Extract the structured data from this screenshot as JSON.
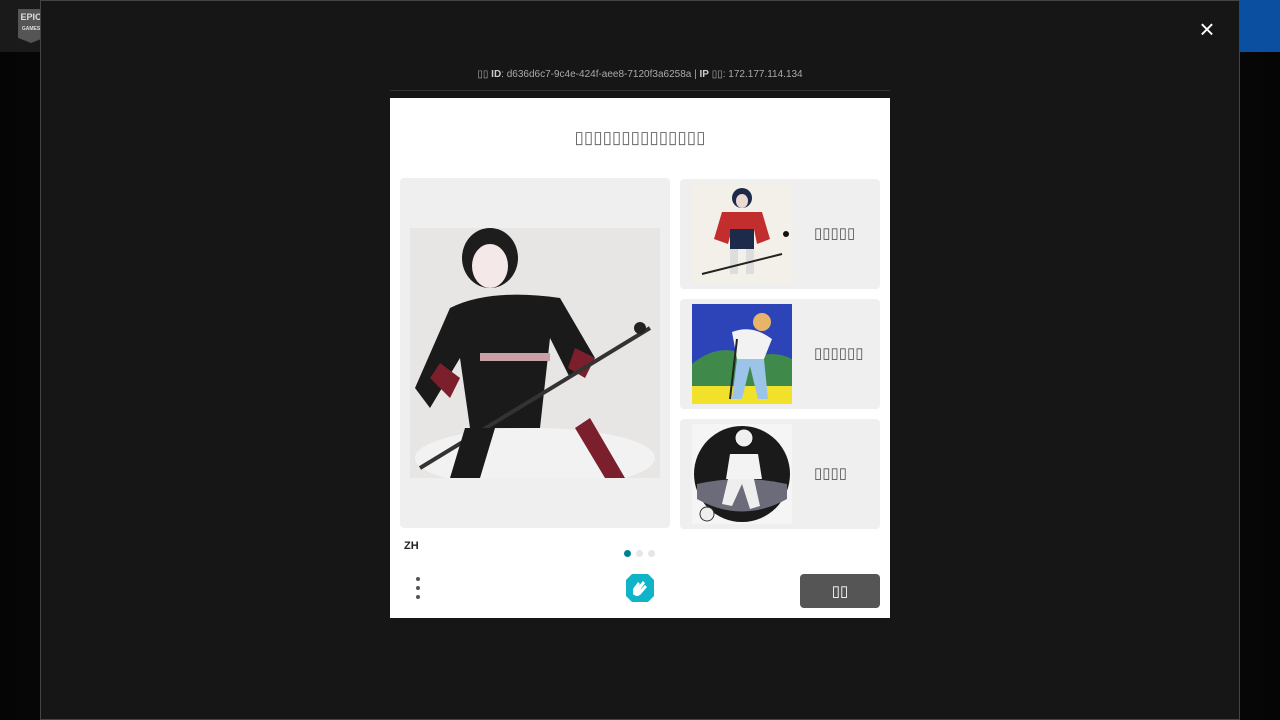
{
  "topbar": {
    "logo_top": "EPIC",
    "logo_bottom": "GAMES"
  },
  "overlay": {
    "close_icon": "×",
    "meta": {
      "id_prefix": "▯▯",
      "id_label": "ID",
      "id_value": ": d636d6c7-9c4e-424f-aee8-7120f3a6258a | ",
      "ip_label": "IP",
      "ip_suffix": " ▯▯",
      "ip_value": ": 172.177.114.134"
    }
  },
  "captcha": {
    "prompt": "▯▯▯▯▯▯▯▯▯▯▯▯▯▯",
    "options": [
      {
        "label": "▯▯▯▯▯",
        "thumb": "hockey-player"
      },
      {
        "label": "▯▯▯▯▯▯",
        "thumb": "golfer"
      },
      {
        "label": "▯▯▯▯",
        "thumb": "soccer-player"
      }
    ],
    "language": "ZH",
    "pagination": {
      "current": 1,
      "total": 3
    },
    "submit_label": "▯▯",
    "accent_color": "#00838f"
  }
}
